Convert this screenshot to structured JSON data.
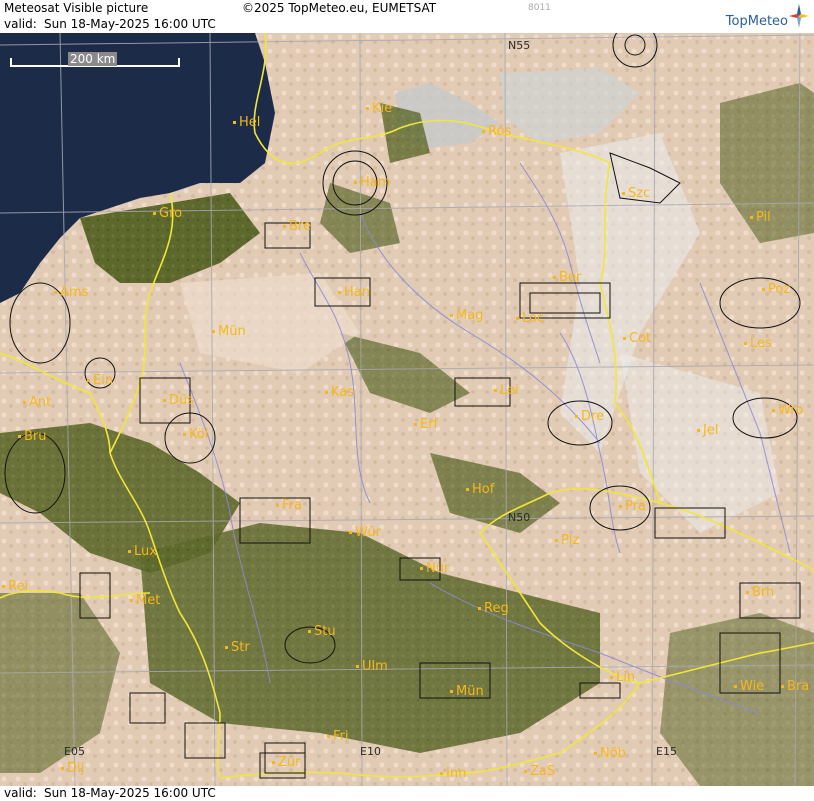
{
  "header": {
    "title": "Meteosat Visible picture",
    "copyright": "©2025 TopMeteo.eu, EUMETSAT",
    "code": "8011",
    "valid_label": "valid:",
    "valid_time": "Sun  18-May-2025  16:00 UTC"
  },
  "footer": {
    "valid_label": "valid:",
    "valid_time": "Sun  18-May-2025  16:00 UTC"
  },
  "logo": {
    "name": "TopMeteo"
  },
  "scale_bar": {
    "label": "200 km"
  },
  "grid_labels": {
    "n55": "N55",
    "n50": "N50",
    "e05": "E05",
    "e10": "E10",
    "e15": "E15"
  },
  "cities": [
    {
      "id": "hel",
      "label": "Hel"
    },
    {
      "id": "kie",
      "label": "Kie"
    },
    {
      "id": "ros",
      "label": "Ros"
    },
    {
      "id": "ham",
      "label": "Ham"
    },
    {
      "id": "szc",
      "label": "Szc"
    },
    {
      "id": "gro",
      "label": "Gro"
    },
    {
      "id": "bre1",
      "label": "Bre"
    },
    {
      "id": "pil",
      "label": "Pil"
    },
    {
      "id": "ams",
      "label": "Ams"
    },
    {
      "id": "han",
      "label": "Han"
    },
    {
      "id": "ber",
      "label": "Ber"
    },
    {
      "id": "poz",
      "label": "Poz"
    },
    {
      "id": "mun",
      "label": "Mün"
    },
    {
      "id": "mag",
      "label": "Mag"
    },
    {
      "id": "loc",
      "label": "Loc"
    },
    {
      "id": "cot",
      "label": "Cot"
    },
    {
      "id": "les",
      "label": "Les"
    },
    {
      "id": "ein",
      "label": "Ein"
    },
    {
      "id": "ant",
      "label": "Ant"
    },
    {
      "id": "dus",
      "label": "Düs"
    },
    {
      "id": "kas",
      "label": "Kas"
    },
    {
      "id": "lei",
      "label": "Lei"
    },
    {
      "id": "bru",
      "label": "Bru"
    },
    {
      "id": "kol",
      "label": "Köl"
    },
    {
      "id": "erf",
      "label": "Erf"
    },
    {
      "id": "dre",
      "label": "Dre"
    },
    {
      "id": "wro",
      "label": "Wro"
    },
    {
      "id": "jel",
      "label": "Jel"
    },
    {
      "id": "hof",
      "label": "Hof"
    },
    {
      "id": "fra",
      "label": "Fra"
    },
    {
      "id": "pra",
      "label": "Pra"
    },
    {
      "id": "lux",
      "label": "Lux"
    },
    {
      "id": "wur",
      "label": "Wür"
    },
    {
      "id": "plz",
      "label": "Plz"
    },
    {
      "id": "nur",
      "label": "Nür"
    },
    {
      "id": "rei",
      "label": "Rei"
    },
    {
      "id": "met",
      "label": "Met"
    },
    {
      "id": "reg",
      "label": "Reg"
    },
    {
      "id": "brn",
      "label": "Brn"
    },
    {
      "id": "stu",
      "label": "Stu"
    },
    {
      "id": "str",
      "label": "Str"
    },
    {
      "id": "ulm",
      "label": "Ulm"
    },
    {
      "id": "muc",
      "label": "Mün"
    },
    {
      "id": "lin",
      "label": "Lin"
    },
    {
      "id": "wie",
      "label": "Wie"
    },
    {
      "id": "bra",
      "label": "Bra"
    },
    {
      "id": "fri",
      "label": "Fri"
    },
    {
      "id": "dij",
      "label": "Dij"
    },
    {
      "id": "zur",
      "label": "Zür"
    },
    {
      "id": "inn",
      "label": "Inn"
    },
    {
      "id": "zas",
      "label": "ZaS"
    },
    {
      "id": "nob",
      "label": "Nöb"
    }
  ],
  "colors": {
    "sea": "#1a2a45",
    "land": "#5f6a2e",
    "cloud": "#e4cdb8",
    "border": "#f2e63a",
    "river": "#8a8ad8",
    "label": "#f4b81c"
  }
}
